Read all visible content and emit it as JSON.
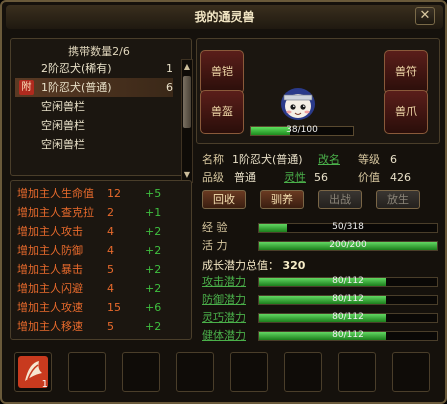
{
  "window": {
    "title": "我的通灵兽",
    "close_label": "✕"
  },
  "carry": {
    "title": "携带数量2/6"
  },
  "pets": [
    {
      "name": "2阶忍犬(稀有)",
      "count": "1",
      "badge": "",
      "selected": false
    },
    {
      "name": "1阶忍犬(普通)",
      "count": "6",
      "badge": "附",
      "selected": true
    },
    {
      "name": "空闲兽栏",
      "count": "",
      "badge": "",
      "selected": false
    },
    {
      "name": "空闲兽栏",
      "count": "",
      "badge": "",
      "selected": false
    },
    {
      "name": "空闲兽栏",
      "count": "",
      "badge": "",
      "selected": false
    }
  ],
  "scroll": {
    "up": "▲",
    "down": "▼"
  },
  "bonuses": [
    {
      "name": "增加主人生命值",
      "value": "12",
      "add": "+5"
    },
    {
      "name": "增加主人查克拉",
      "value": "2",
      "add": "+1"
    },
    {
      "name": "增加主人攻击",
      "value": "4",
      "add": "+2"
    },
    {
      "name": "增加主人防御",
      "value": "4",
      "add": "+2"
    },
    {
      "name": "增加主人暴击",
      "value": "5",
      "add": "+2"
    },
    {
      "name": "增加主人闪避",
      "value": "4",
      "add": "+2"
    },
    {
      "name": "增加主人攻速",
      "value": "15",
      "add": "+6"
    },
    {
      "name": "增加主人移速",
      "value": "5",
      "add": "+2"
    }
  ],
  "equip": {
    "armor": "兽铠",
    "helmet": "兽盔",
    "talisman": "兽符",
    "claw": "兽爪"
  },
  "pet_hp": {
    "text": "38/100",
    "fraction": 0.38
  },
  "info": {
    "name_label": "名称",
    "name_value": "1阶忍犬(普通)",
    "rename": "改名",
    "level_label": "等级",
    "level_value": "6",
    "grade_label": "品级",
    "grade_value": "普通",
    "spirit_label": "灵性",
    "spirit_value": "56",
    "price_label": "价值",
    "price_value": "426"
  },
  "actions": {
    "recall": "回收",
    "train": "驯养",
    "fight": "出战",
    "release": "放生"
  },
  "stats": {
    "exp_label": "经  验",
    "exp_text": "50/318",
    "exp_fraction": 0.157,
    "vit_label": "活  力",
    "vit_text": "200/200",
    "vit_fraction": 1.0
  },
  "growth": {
    "label": "成长潜力总值：",
    "value": "320"
  },
  "potentials": [
    {
      "label": "攻击潜力",
      "text": "80/112",
      "fraction": 0.714
    },
    {
      "label": "防御潜力",
      "text": "80/112",
      "fraction": 0.714
    },
    {
      "label": "灵巧潜力",
      "text": "80/112",
      "fraction": 0.714
    },
    {
      "label": "健体潜力",
      "text": "80/112",
      "fraction": 0.714
    }
  ],
  "slots": {
    "first_item_count": "1",
    "total": 8
  },
  "colors": {
    "bonus_text": "#e86a2c",
    "bonus_add": "#3fbf3f",
    "bar_fill": "#3cb83c",
    "link": "#4ab04a"
  }
}
